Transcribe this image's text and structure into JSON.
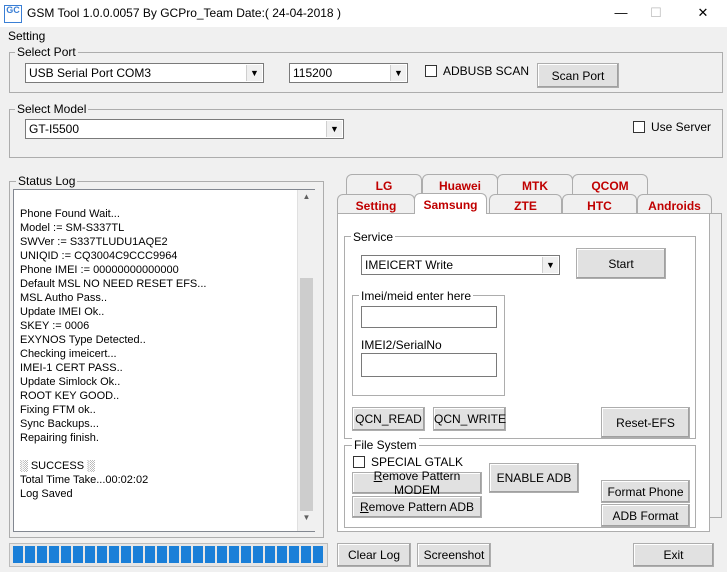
{
  "window": {
    "title": "GSM Tool 1.0.0.0057 By GCPro_Team  Date:( 24-04-2018 )",
    "app_icon_text": "GC",
    "minimize": "—",
    "maximize": "☐",
    "close": "✕"
  },
  "menu": {
    "setting": "Setting"
  },
  "select_port": {
    "label": "Select Port",
    "port_value": "USB Serial Port COM3",
    "baud_value": "115200",
    "adbusb_label": "ADBUSB SCAN",
    "scan_button": "Scan Port"
  },
  "select_model": {
    "label": "Select Model",
    "model_value": "GT-I5500",
    "use_server_label": "Use Server"
  },
  "status_log": {
    "label": "Status Log",
    "lines": [
      "Phone Found Wait...",
      "Model := SM-S337TL",
      "SWVer := S337TLUDU1AQE2",
      "UNIQID := CQ3004C9CCC9964",
      "Phone IMEI := 00000000000000",
      "Default MSL NO NEED RESET EFS...",
      "MSL Autho Pass..",
      "Update IMEI Ok..",
      "SKEY := 0006",
      "EXYNOS Type Detected..",
      "Checking imeicert...",
      "IMEI-1 CERT PASS..",
      "Update Simlock Ok..",
      "ROOT KEY GOOD..",
      "Fixing FTM ok..",
      "Sync Backups...",
      "Repairing finish.",
      "",
      "░ SUCCESS ░",
      "Total Time Take...00:02:02",
      "Log Saved"
    ],
    "scroll_up": "▲",
    "scroll_down": "▼"
  },
  "progress": {
    "fraction": 1.0,
    "segments": 26
  },
  "tabs_top": [
    "LG",
    "Huawei",
    "MTK",
    "QCOM"
  ],
  "tabs_bottom": [
    "Setting",
    "Samsung",
    "ZTE",
    "HTC",
    "Androids"
  ],
  "active_tab": "Samsung",
  "accent_color": "#c00000",
  "service": {
    "label": "Service",
    "mode_value": "IMEICERT Write",
    "start_button": "Start",
    "imei_group_label": "Imei/meid enter here",
    "imei_value": "",
    "imei2_label": "IMEI2/SerialNo",
    "imei2_value": "",
    "qcn_read": "QCN_READ",
    "qcn_write": "QCN_WRITE",
    "reset_efs": "Reset-EFS"
  },
  "file_system": {
    "label": "File System",
    "special_gtalk": "SPECIAL GTALK",
    "remove_pattern_modem": "emove Pattern MODEM",
    "remove_pattern_adb": "emove Pattern ADB",
    "mnemonic": "R",
    "enable_adb": "ENABLE ADB",
    "format_phone": "Format Phone",
    "adb_format": "ADB Format"
  },
  "bottom_buttons": {
    "clear_log": "Clear Log",
    "screenshot": "Screenshot",
    "exit": "Exit"
  }
}
